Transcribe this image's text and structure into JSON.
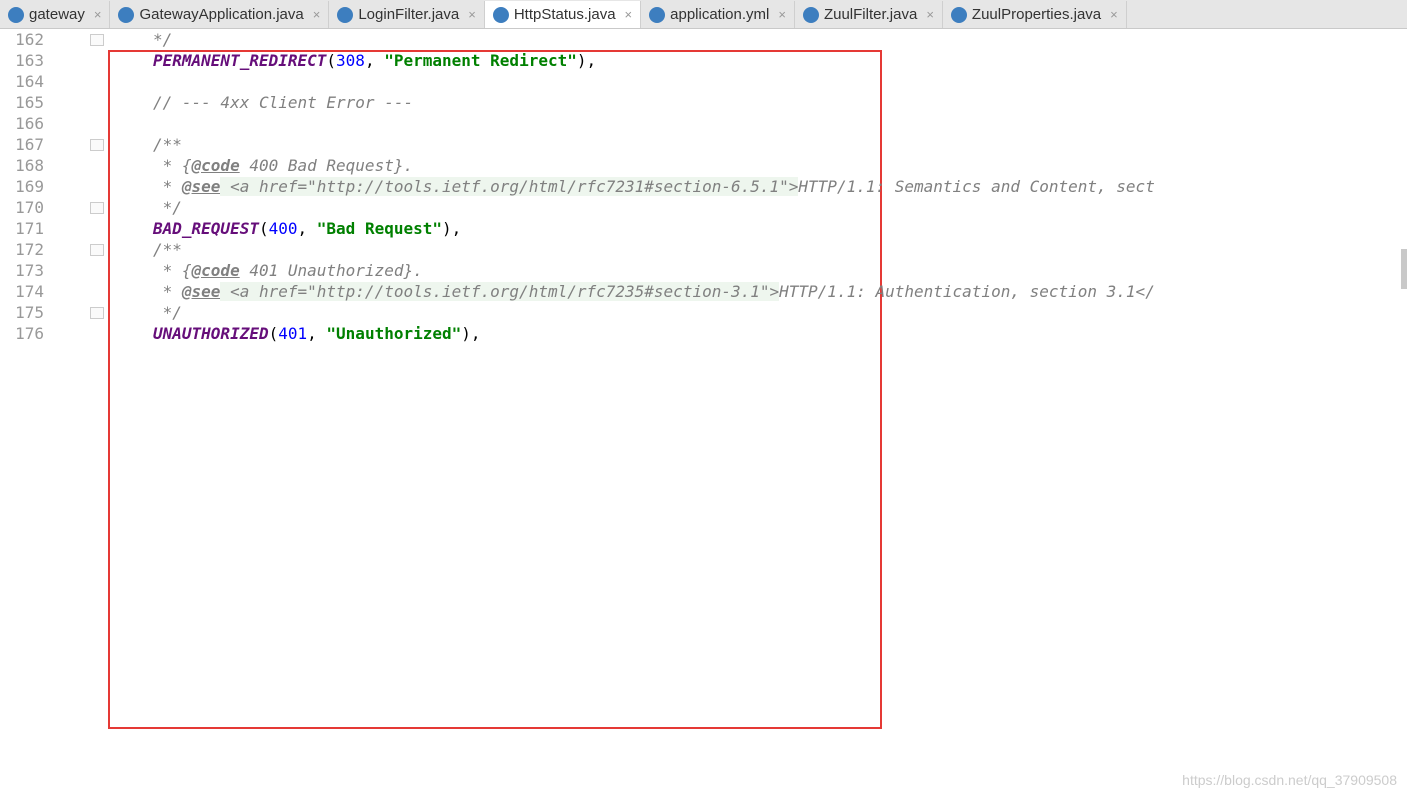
{
  "tabs": [
    {
      "label": "gateway"
    },
    {
      "label": "GatewayApplication.java"
    },
    {
      "label": "LoginFilter.java"
    },
    {
      "label": "HttpStatus.java",
      "active": true
    },
    {
      "label": "application.yml"
    },
    {
      "label": "ZuulFilter.java"
    },
    {
      "label": "ZuulProperties.java"
    }
  ],
  "editor": {
    "lines": [
      {
        "n": "162",
        "code": [
          {
            "c": "cmt",
            "t": "*/"
          }
        ],
        "fold": true
      },
      {
        "n": "163",
        "code": [
          {
            "c": "kw",
            "t": "PERMANENT_REDIRECT"
          },
          {
            "c": "",
            "t": "("
          },
          {
            "c": "num",
            "t": "308"
          },
          {
            "c": "",
            "t": ", "
          },
          {
            "c": "str",
            "t": "\"Permanent Redirect\""
          },
          {
            "c": "",
            "t": "),"
          }
        ]
      },
      {
        "n": "164",
        "code": []
      },
      {
        "n": "165",
        "code": [
          {
            "c": "cmt",
            "t": "// --- 4xx Client Error ---"
          }
        ]
      },
      {
        "n": "166",
        "code": []
      },
      {
        "n": "167",
        "code": [
          {
            "c": "cmt",
            "t": "/**"
          }
        ],
        "fold": true
      },
      {
        "n": "168",
        "code": [
          {
            "c": "cmt",
            "t": " * {"
          },
          {
            "c": "tag",
            "t": "@code"
          },
          {
            "c": "cmt",
            "t": " 400 Bad Request}."
          }
        ]
      },
      {
        "n": "169",
        "code": [
          {
            "c": "cmt",
            "t": " * "
          },
          {
            "c": "tag",
            "t": "@see"
          },
          {
            "c": "url",
            "t": " <a href=\"http://tools.ietf.org/html/rfc7231#section-6.5.1\">"
          },
          {
            "c": "cmt",
            "t": "HTTP/1.1: Semantics and Content, sect"
          }
        ]
      },
      {
        "n": "170",
        "code": [
          {
            "c": "cmt",
            "t": " */"
          }
        ],
        "fold": true
      },
      {
        "n": "171",
        "code": [
          {
            "c": "kw",
            "t": "BAD_REQUEST"
          },
          {
            "c": "",
            "t": "("
          },
          {
            "c": "num",
            "t": "400"
          },
          {
            "c": "",
            "t": ", "
          },
          {
            "c": "str",
            "t": "\"Bad Request\""
          },
          {
            "c": "",
            "t": "),"
          }
        ]
      },
      {
        "n": "172",
        "code": [
          {
            "c": "cmt",
            "t": "/**"
          }
        ],
        "fold": true
      },
      {
        "n": "173",
        "code": [
          {
            "c": "cmt",
            "t": " * {"
          },
          {
            "c": "tag",
            "t": "@code"
          },
          {
            "c": "cmt",
            "t": " 401 Unauthorized}."
          }
        ]
      },
      {
        "n": "174",
        "code": [
          {
            "c": "cmt",
            "t": " * "
          },
          {
            "c": "tag",
            "t": "@see"
          },
          {
            "c": "url",
            "t": " <a href=\"http://tools.ietf.org/html/rfc7235#section-3.1\">"
          },
          {
            "c": "cmt",
            "t": "HTTP/1.1: Authentication, section 3.1</"
          }
        ]
      },
      {
        "n": "175",
        "code": [
          {
            "c": "cmt",
            "t": " */"
          }
        ],
        "fold": true
      },
      {
        "n": "176",
        "code": [
          {
            "c": "kw",
            "t": "UNAUTHORIZED"
          },
          {
            "c": "",
            "t": "("
          },
          {
            "c": "num",
            "t": "401"
          },
          {
            "c": "",
            "t": ", "
          },
          {
            "c": "str",
            "t": "\"Unauthorized\""
          },
          {
            "c": "",
            "t": "),"
          }
        ]
      }
    ]
  },
  "watermark": "https://blog.csdn.net/qq_37909508"
}
